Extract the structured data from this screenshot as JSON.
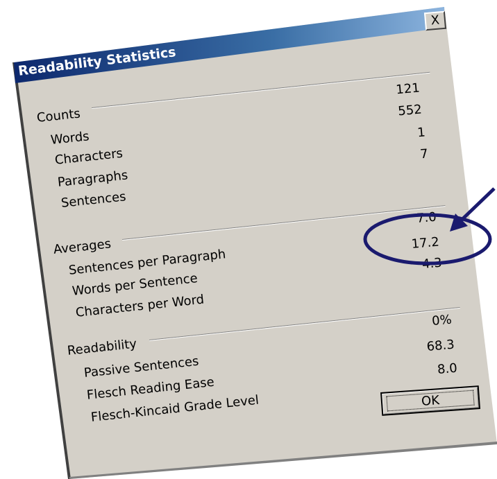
{
  "dialog": {
    "title": "Readability Statistics",
    "close_label": "X",
    "ok_label": "OK"
  },
  "counts": {
    "header": "Counts",
    "rows": [
      {
        "label": "Words",
        "value": "121"
      },
      {
        "label": "Characters",
        "value": "552"
      },
      {
        "label": "Paragraphs",
        "value": "1"
      },
      {
        "label": "Sentences",
        "value": "7"
      }
    ]
  },
  "averages": {
    "header": "Averages",
    "rows": [
      {
        "label": "Sentences per Paragraph",
        "value": "7.0"
      },
      {
        "label": "Words per Sentence",
        "value": "17.2"
      },
      {
        "label": "Characters per Word",
        "value": "4.3"
      }
    ]
  },
  "readability": {
    "header": "Readability",
    "rows": [
      {
        "label": "Passive Sentences",
        "value": "0%"
      },
      {
        "label": "Flesch Reading Ease",
        "value": "68.3"
      },
      {
        "label": "Flesch-Kincaid Grade Level",
        "value": "8.0"
      }
    ]
  },
  "annotation": {
    "color": "#1a1a6e",
    "highlighted_value": "17.2"
  }
}
